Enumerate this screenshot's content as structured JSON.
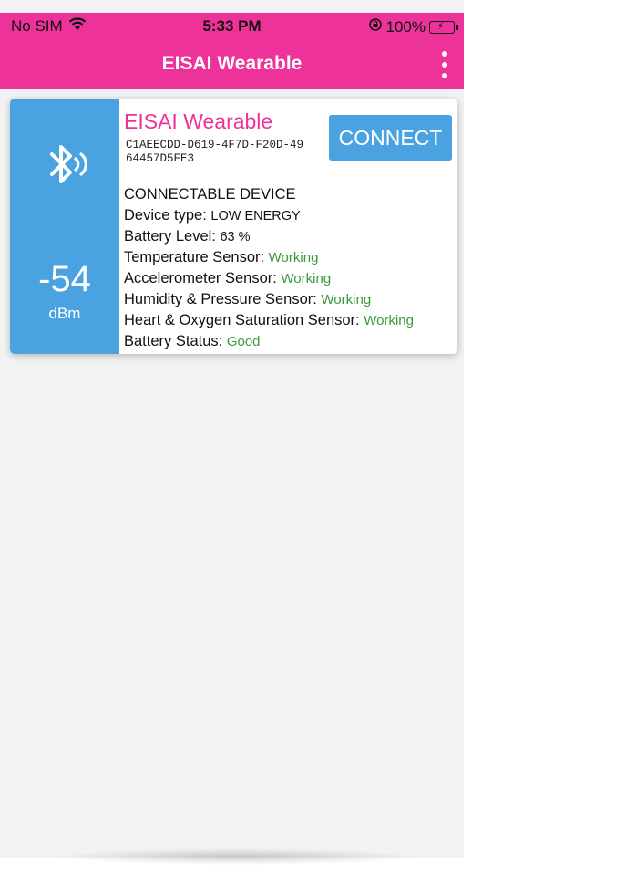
{
  "status_bar": {
    "carrier": "No SIM",
    "time": "5:33 PM",
    "battery": "100%",
    "icons": [
      "wifi-icon",
      "orientation-lock-icon",
      "battery-charging-icon"
    ]
  },
  "app_bar": {
    "title": "EISAI Wearable",
    "menu_icon": "more-vertical-icon"
  },
  "device": {
    "name": "EISAI Wearable",
    "uuid": "C1AEECDD-D619-4F7D-F20D-4964457D5FE3",
    "rssi": "-54",
    "rssi_unit": "dBm",
    "icon": "bluetooth-signal-icon",
    "connect_label": "CONNECT",
    "connectable": "CONNECTABLE DEVICE",
    "device_type_label": "Device type:",
    "device_type_value": "LOW ENERGY",
    "battery_level_label": "Battery Level:",
    "battery_level_value": "63 %",
    "sensors": [
      {
        "label": "Temperature Sensor:",
        "status": "Working"
      },
      {
        "label": "Accelerometer Sensor:",
        "status": "Working"
      },
      {
        "label": "Humidity & Pressure Sensor:",
        "status": "Working"
      },
      {
        "label": "Heart & Oxygen Saturation Sensor:",
        "status": "Working"
      },
      {
        "label": "Battery Status:",
        "status": "Good"
      }
    ]
  },
  "colors": {
    "accent_pink": "#ed3399",
    "accent_blue": "#4aa3e0",
    "status_ok": "#3a9a3a",
    "background": "#f2f2f2"
  }
}
